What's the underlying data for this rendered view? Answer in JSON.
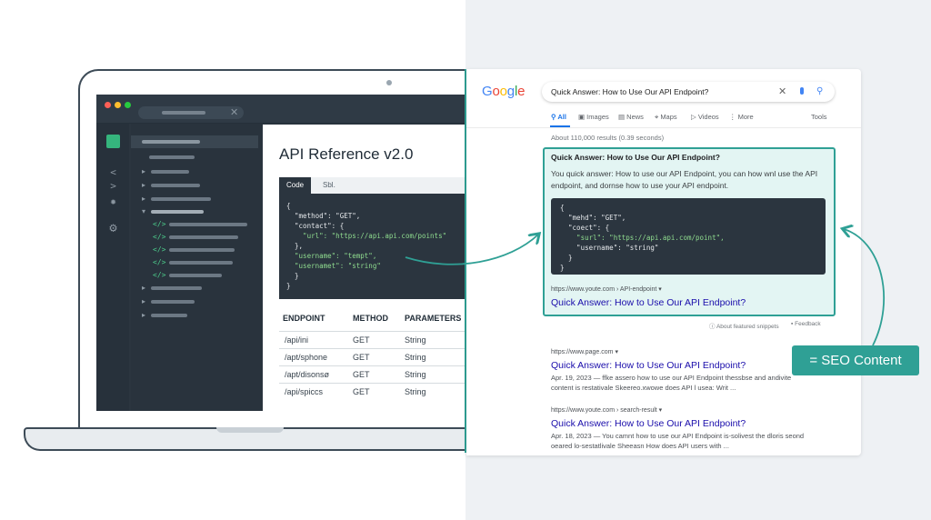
{
  "colors": {
    "teal_accent": "#2fa095",
    "code_bg": "#2b353f",
    "link_blue": "#1a0dab",
    "google_blue": "#4285f4",
    "google_red": "#ea4335",
    "google_yellow": "#fbbc05",
    "google_green": "#34a853"
  },
  "editor": {
    "sidebar_icons": [
      "files-icon",
      "code-icon",
      "bug-icon",
      "gear-icon"
    ],
    "page_title": "API Reference v2.0",
    "code_tabs": [
      "Code",
      "Sbl."
    ],
    "code_lines": [
      "{",
      "  \"method\": \"GET\",",
      "  \"contact\": {",
      "    \"url\": \"https://api.api.com/points\"",
      "  },",
      "  \"username\": \"tempt\",",
      "  \"usernamet\": \"string\"",
      "  }",
      "}"
    ],
    "table": {
      "headers": [
        "ENDPOINT",
        "METHOD",
        "PARAMETERS"
      ],
      "rows": [
        [
          "/api/ini",
          "GET",
          "String"
        ],
        [
          "/apt/sphone",
          "GET",
          "String"
        ],
        [
          "/apt/disonsø",
          "GET",
          "String"
        ],
        [
          "/api/spiccs",
          "GET",
          "String"
        ]
      ]
    }
  },
  "google": {
    "logo": "Google",
    "query": "Quick Answer: How to Use Our API Endpoint?",
    "nav": [
      "All",
      "Images",
      "News",
      "Maps",
      "Videos",
      "More",
      "Tools"
    ],
    "result_count": "About 110,000 results (0.39 seconds)",
    "featured": {
      "title": "Quick Answer: How to Use Our API Endpoint?",
      "description": "You quick answer: How to use our API Endpoint, you can how wnl use the API endpoint, and dornse how to use your API endpoint.",
      "code_lines": [
        "{",
        "  \"mehd\": \"GET\",",
        "  \"coect\": {",
        "    \"surl\": \"https://api.api.com/point\",",
        "    \"username\": \"string\"",
        "  }",
        "}"
      ],
      "url": "https://www.youte.com › API-endpoint",
      "link": "Quick Answer: How to Use Our API Endpoint?",
      "about": "About featured snippets",
      "feedback": "Feedback"
    },
    "results": [
      {
        "url": "https://www.page.com",
        "title": "Quick Answer: How to Use Our API Endpoint?",
        "snippet": "Apr. 19, 2023 — ffke assero how to use our API Endpoint thessbse and andivite content is restativale Skeereo.xwowe does API l usea: Writ ..."
      },
      {
        "url": "https://www.youte.com › search-result",
        "title": "Quick Answer: How to Use Our API Endpoint?",
        "snippet": "Apr. 18, 2023 — You camnt how to use our API Endpoint is-solivest the dloris seond oeared lo-sestatlivale Sheeasn How does API users with ..."
      }
    ]
  },
  "badge": "= SEO Content"
}
